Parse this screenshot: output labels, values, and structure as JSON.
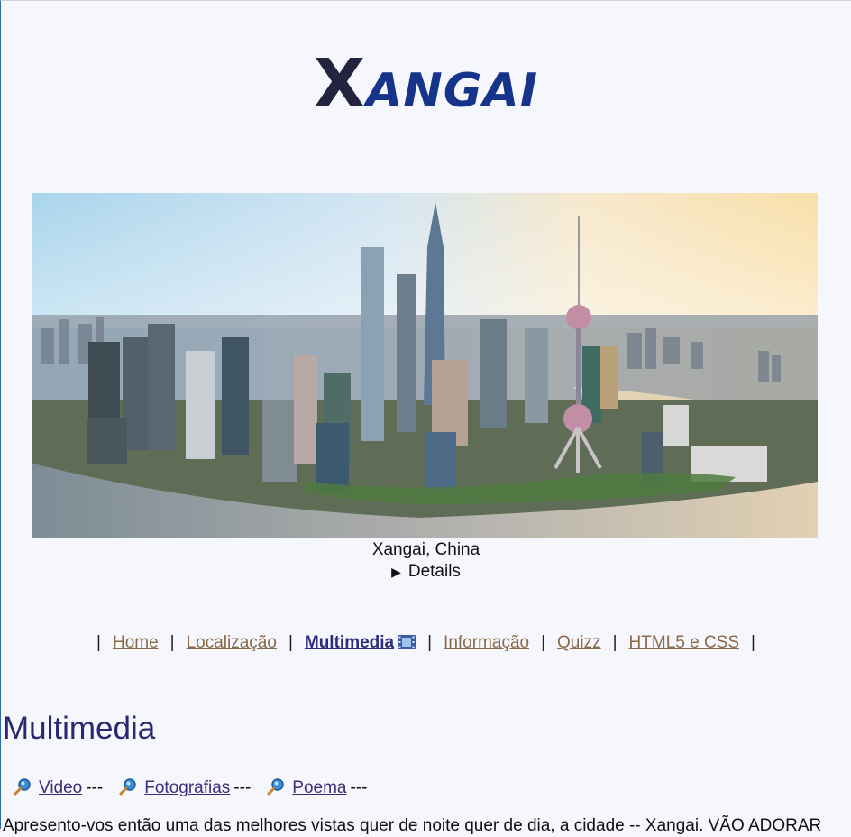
{
  "header": {
    "title_first_letter": "X",
    "title_rest": "ANGAI"
  },
  "hero": {
    "caption": "Xangai, China",
    "details_label": "Details",
    "details_icon": "triangle-right-icon"
  },
  "nav": {
    "items": [
      {
        "label": "Home"
      },
      {
        "label": "Localização"
      },
      {
        "label": "Multimedia",
        "active": true,
        "icon": "film-icon"
      },
      {
        "label": "Informação"
      },
      {
        "label": "Quizz"
      },
      {
        "label": "HTML5 e CSS"
      }
    ],
    "separator": "|"
  },
  "main": {
    "heading": "Multimedia",
    "sublinks": [
      {
        "label": "Video",
        "icon": "magnifier-icon"
      },
      {
        "label": "Fotografias",
        "icon": "magnifier-icon"
      },
      {
        "label": "Poema",
        "icon": "magnifier-icon"
      }
    ],
    "sublink_suffix": "---",
    "paragraph": "Apresento-vos então uma das melhores vistas quer de noite quer de dia, a cidade -- Xangai. VÃO ADORAR"
  },
  "colors": {
    "background": "#f6f7fc",
    "title": "#16348a",
    "nav_link": "#8a6a48",
    "nav_active": "#2d2d7e",
    "heading": "#2a2870"
  }
}
